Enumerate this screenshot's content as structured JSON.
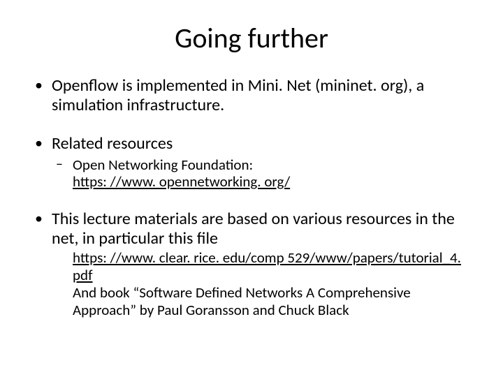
{
  "title": "Going further",
  "bullets": {
    "b1": "Openflow is implemented in Mini. Net (mininet. org), a simulation infrastructure.",
    "b2": "Related resources",
    "b2_sub_label": "Open Networking Foundation:",
    "b2_sub_link": "https: //www. opennetworking. org/",
    "b3": "This lecture materials are based on various resources in the net, in particular this file",
    "b3_link": "https: //www. clear. rice. edu/comp 529/www/papers/tutorial_4. pdf",
    "b3_text": "And book “Software Defined Networks A Comprehensive Approach” by Paul Goransson and Chuck Black"
  }
}
